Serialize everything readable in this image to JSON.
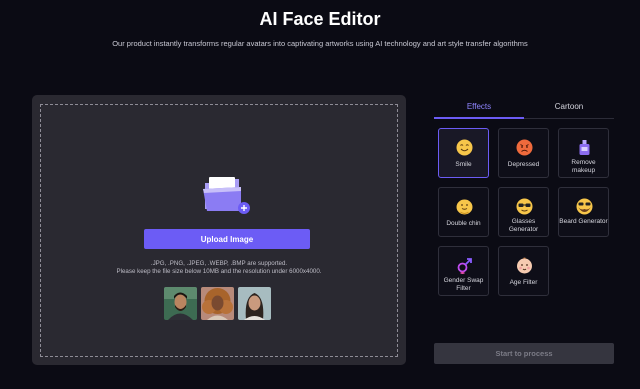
{
  "header": {
    "title": "AI Face Editor",
    "subtitle": "Our product instantly transforms regular avatars into captivating artworks using AI technology and art style transfer algorithms"
  },
  "upload": {
    "button_label": "Upload Image",
    "formats_hint": ".JPG, .PNG, .JPEG, .WEBP, .BMP are supported.",
    "size_hint": "Please keep the file size below 10MB and the resolution under 6000x4000.",
    "samples": [
      "sample-man",
      "sample-woman-curly",
      "sample-woman"
    ]
  },
  "tabs": [
    {
      "label": "Effects",
      "active": true
    },
    {
      "label": "Cartoon",
      "active": false
    }
  ],
  "effects": [
    {
      "label": "Smile",
      "icon": "smile-icon",
      "selected": true
    },
    {
      "label": "Depressed",
      "icon": "depressed-icon",
      "selected": false
    },
    {
      "label": "Remove makeup",
      "icon": "makeup-bottle-icon",
      "selected": false
    },
    {
      "label": "Double chin",
      "icon": "double-chin-icon",
      "selected": false
    },
    {
      "label": "Glasses Generator",
      "icon": "glasses-icon",
      "selected": false
    },
    {
      "label": "Beard Generator",
      "icon": "beard-icon",
      "selected": false
    },
    {
      "label": "Gender Swap Filter",
      "icon": "gender-swap-icon",
      "selected": false
    },
    {
      "label": "Age Filter",
      "icon": "baby-face-icon",
      "selected": false
    }
  ],
  "process_button_label": "Start to process",
  "colors": {
    "accent": "#6c5cf5",
    "background": "#0b0b14",
    "card": "#2a2931"
  }
}
